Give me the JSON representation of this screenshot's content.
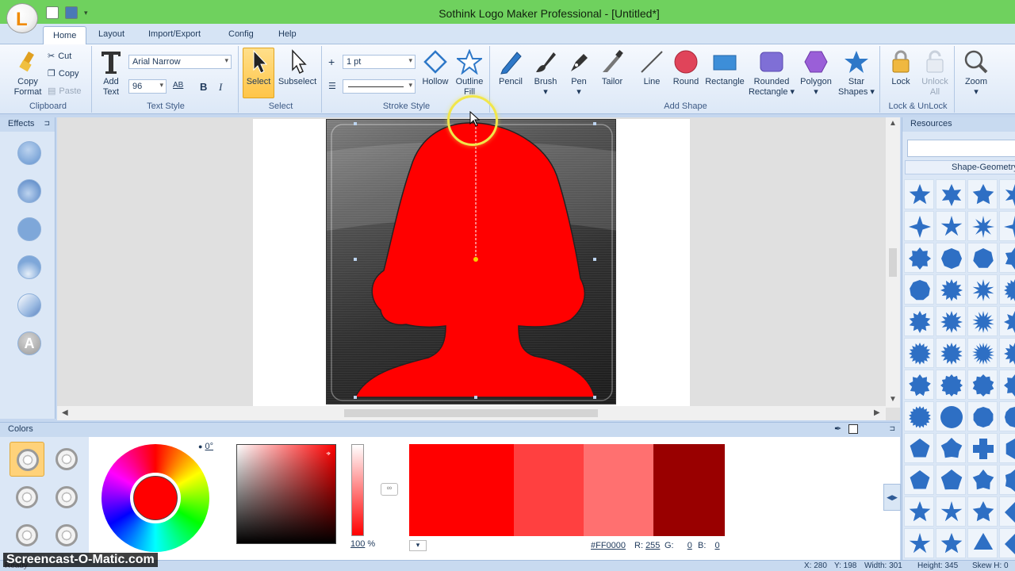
{
  "window": {
    "title": "Sothink Logo Maker Professional - [Untitled*]"
  },
  "menu": {
    "tabs": [
      {
        "label": "Home",
        "active": true
      },
      {
        "label": "Layout"
      },
      {
        "label": "Import/Export"
      },
      {
        "label": "Config"
      },
      {
        "label": "Help"
      }
    ]
  },
  "ribbon": {
    "clipboard": {
      "label": "Clipboard",
      "copy_format": "Copy Format",
      "cut": "Cut",
      "copy": "Copy",
      "paste": "Paste"
    },
    "text_style": {
      "label": "Text Style",
      "add_text": "Add Text",
      "font": "Arial Narrow",
      "size": "96",
      "bold": "B",
      "italic": "I",
      "ab": "AB"
    },
    "select": {
      "label": "Select",
      "select": "Select",
      "subselect": "Subselect"
    },
    "stroke_style": {
      "label": "Stroke Style",
      "width": "1 pt",
      "hollow": "Hollow",
      "outline": "Outline",
      "fill": "Fill"
    },
    "add_shape": {
      "label": "Add Shape",
      "pencil": "Pencil",
      "brush": "Brush",
      "pen": "Pen",
      "tailor": "Tailor",
      "line": "Line",
      "round": "Round",
      "rectangle": "Rectangle",
      "rounded_rectangle": "Rounded Rectangle",
      "polygon": "Polygon",
      "star_shapes": "Star Shapes"
    },
    "lock": {
      "label": "Lock & UnLock",
      "lock": "Lock",
      "unlock_all": "Unlock All"
    },
    "zoom": {
      "zoom": "Zoom"
    }
  },
  "effects": {
    "title": "Effects",
    "text_effect": "A"
  },
  "resources": {
    "title": "Resources",
    "category": "Shape-Geometry"
  },
  "colors": {
    "title": "Colors",
    "angle": "0°",
    "alpha": "100",
    "alpha_unit": "%",
    "hex": "#FF0000",
    "r_label": "R:",
    "r": "255",
    "g_label": "G:",
    "g": "0",
    "b_label": "B:",
    "b": "0",
    "current": "#ff0000",
    "swatches": [
      "#ff0000",
      "#ff4040",
      "#ff7070",
      "#990000"
    ]
  },
  "status": {
    "left": "Ready",
    "x": "X: 280",
    "y": "Y: 198",
    "width": "Width: 301",
    "height": "Height: 345",
    "skew": "Skew H: 0"
  },
  "watermark": "Screencast-O-Matic.com"
}
